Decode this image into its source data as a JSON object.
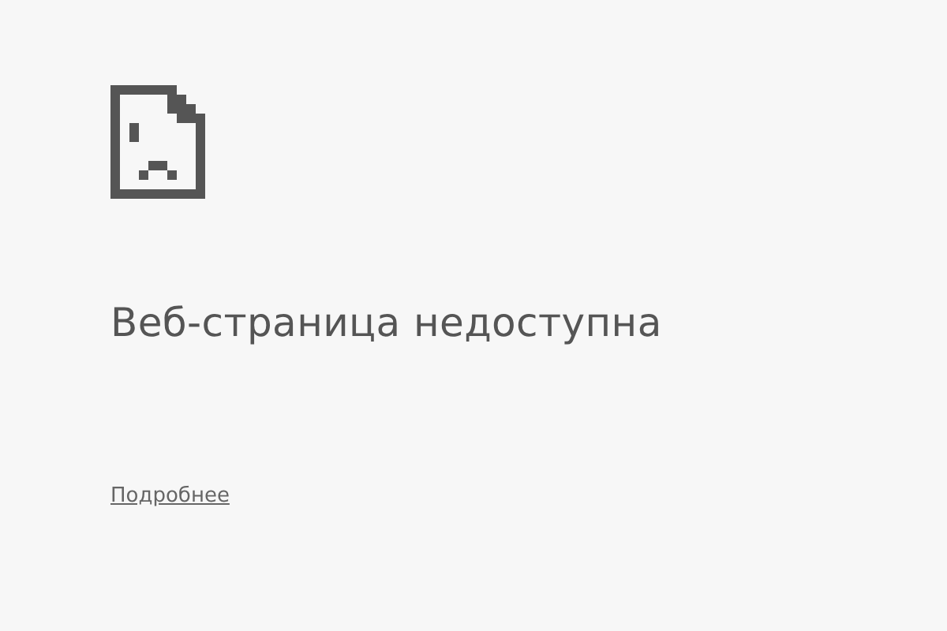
{
  "error": {
    "heading": "Веб-страница недоступна",
    "link": "Подробнее"
  }
}
